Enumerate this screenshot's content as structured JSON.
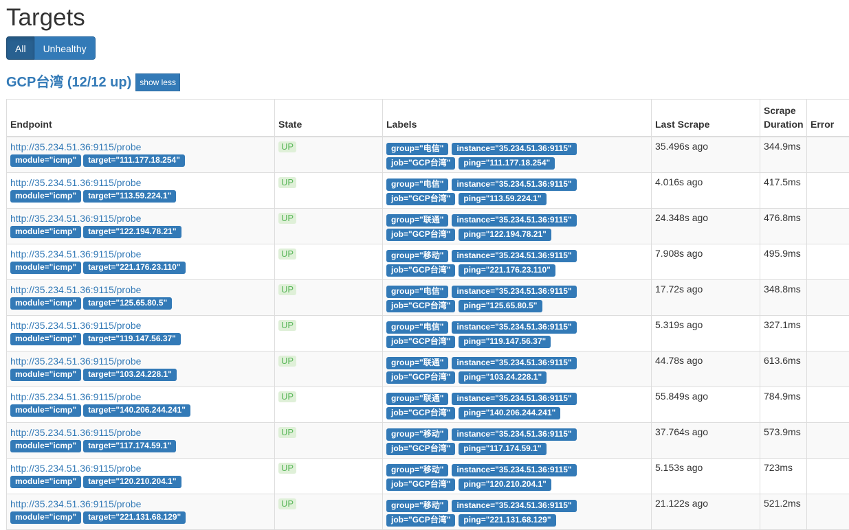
{
  "page": {
    "title": "Targets"
  },
  "filters": {
    "all_label": "All",
    "unhealthy_label": "Unhealthy"
  },
  "job": {
    "title": "GCP台湾 (12/12 up)",
    "toggle_label": "show less"
  },
  "columns": {
    "endpoint": "Endpoint",
    "state": "State",
    "labels": "Labels",
    "last_scrape": "Last Scrape",
    "scrape_duration": "Scrape Duration",
    "error": "Error"
  },
  "rows": [
    {
      "endpoint": "http://35.234.51.36:9115/probe",
      "module": "module=\"icmp\"",
      "target": "target=\"111.177.18.254\"",
      "state": "UP",
      "group": "group=\"电信\"",
      "instance": "instance=\"35.234.51.36:9115\"",
      "job": "job=\"GCP台湾\"",
      "ping": "ping=\"111.177.18.254\"",
      "last_scrape": "35.496s ago",
      "duration": "344.9ms",
      "error": ""
    },
    {
      "endpoint": "http://35.234.51.36:9115/probe",
      "module": "module=\"icmp\"",
      "target": "target=\"113.59.224.1\"",
      "state": "UP",
      "group": "group=\"电信\"",
      "instance": "instance=\"35.234.51.36:9115\"",
      "job": "job=\"GCP台湾\"",
      "ping": "ping=\"113.59.224.1\"",
      "last_scrape": "4.016s ago",
      "duration": "417.5ms",
      "error": ""
    },
    {
      "endpoint": "http://35.234.51.36:9115/probe",
      "module": "module=\"icmp\"",
      "target": "target=\"122.194.78.21\"",
      "state": "UP",
      "group": "group=\"联通\"",
      "instance": "instance=\"35.234.51.36:9115\"",
      "job": "job=\"GCP台湾\"",
      "ping": "ping=\"122.194.78.21\"",
      "last_scrape": "24.348s ago",
      "duration": "476.8ms",
      "error": ""
    },
    {
      "endpoint": "http://35.234.51.36:9115/probe",
      "module": "module=\"icmp\"",
      "target": "target=\"221.176.23.110\"",
      "state": "UP",
      "group": "group=\"移动\"",
      "instance": "instance=\"35.234.51.36:9115\"",
      "job": "job=\"GCP台湾\"",
      "ping": "ping=\"221.176.23.110\"",
      "last_scrape": "7.908s ago",
      "duration": "495.9ms",
      "error": ""
    },
    {
      "endpoint": "http://35.234.51.36:9115/probe",
      "module": "module=\"icmp\"",
      "target": "target=\"125.65.80.5\"",
      "state": "UP",
      "group": "group=\"电信\"",
      "instance": "instance=\"35.234.51.36:9115\"",
      "job": "job=\"GCP台湾\"",
      "ping": "ping=\"125.65.80.5\"",
      "last_scrape": "17.72s ago",
      "duration": "348.8ms",
      "error": ""
    },
    {
      "endpoint": "http://35.234.51.36:9115/probe",
      "module": "module=\"icmp\"",
      "target": "target=\"119.147.56.37\"",
      "state": "UP",
      "group": "group=\"电信\"",
      "instance": "instance=\"35.234.51.36:9115\"",
      "job": "job=\"GCP台湾\"",
      "ping": "ping=\"119.147.56.37\"",
      "last_scrape": "5.319s ago",
      "duration": "327.1ms",
      "error": ""
    },
    {
      "endpoint": "http://35.234.51.36:9115/probe",
      "module": "module=\"icmp\"",
      "target": "target=\"103.24.228.1\"",
      "state": "UP",
      "group": "group=\"联通\"",
      "instance": "instance=\"35.234.51.36:9115\"",
      "job": "job=\"GCP台湾\"",
      "ping": "ping=\"103.24.228.1\"",
      "last_scrape": "44.78s ago",
      "duration": "613.6ms",
      "error": ""
    },
    {
      "endpoint": "http://35.234.51.36:9115/probe",
      "module": "module=\"icmp\"",
      "target": "target=\"140.206.244.241\"",
      "state": "UP",
      "group": "group=\"联通\"",
      "instance": "instance=\"35.234.51.36:9115\"",
      "job": "job=\"GCP台湾\"",
      "ping": "ping=\"140.206.244.241\"",
      "last_scrape": "55.849s ago",
      "duration": "784.9ms",
      "error": ""
    },
    {
      "endpoint": "http://35.234.51.36:9115/probe",
      "module": "module=\"icmp\"",
      "target": "target=\"117.174.59.1\"",
      "state": "UP",
      "group": "group=\"移动\"",
      "instance": "instance=\"35.234.51.36:9115\"",
      "job": "job=\"GCP台湾\"",
      "ping": "ping=\"117.174.59.1\"",
      "last_scrape": "37.764s ago",
      "duration": "573.9ms",
      "error": ""
    },
    {
      "endpoint": "http://35.234.51.36:9115/probe",
      "module": "module=\"icmp\"",
      "target": "target=\"120.210.204.1\"",
      "state": "UP",
      "group": "group=\"移动\"",
      "instance": "instance=\"35.234.51.36:9115\"",
      "job": "job=\"GCP台湾\"",
      "ping": "ping=\"120.210.204.1\"",
      "last_scrape": "5.153s ago",
      "duration": "723ms",
      "error": ""
    },
    {
      "endpoint": "http://35.234.51.36:9115/probe",
      "module": "module=\"icmp\"",
      "target": "target=\"221.131.68.129\"",
      "state": "UP",
      "group": "group=\"移动\"",
      "instance": "instance=\"35.234.51.36:9115\"",
      "job": "job=\"GCP台湾\"",
      "ping": "ping=\"221.131.68.129\"",
      "last_scrape": "21.122s ago",
      "duration": "521.2ms",
      "error": ""
    }
  ]
}
